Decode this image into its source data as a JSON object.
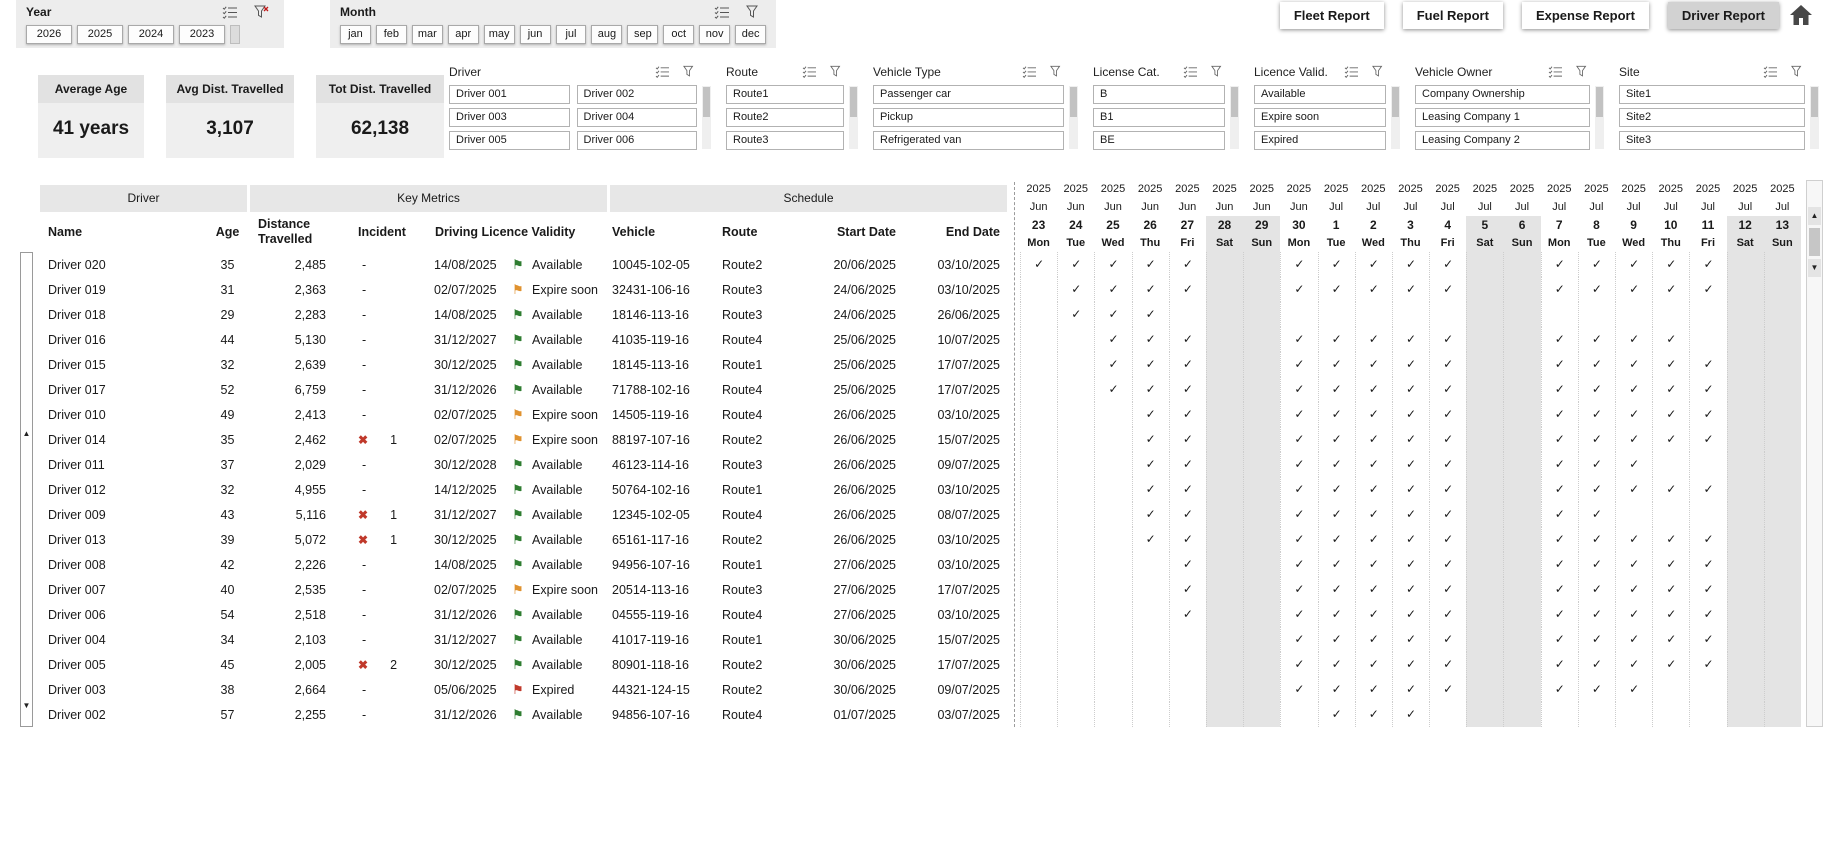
{
  "filters": {
    "year": {
      "label": "Year",
      "options": [
        "2026",
        "2025",
        "2024",
        "2023"
      ]
    },
    "month": {
      "label": "Month",
      "options": [
        "jan",
        "feb",
        "mar",
        "apr",
        "may",
        "jun",
        "jul",
        "aug",
        "sep",
        "oct",
        "nov",
        "dec"
      ]
    }
  },
  "nav": {
    "buttons": [
      {
        "label": "Fleet Report",
        "active": false
      },
      {
        "label": "Fuel Report",
        "active": false
      },
      {
        "label": "Expense Report",
        "active": false
      },
      {
        "label": "Driver Report",
        "active": true
      }
    ]
  },
  "kpis": [
    {
      "title": "Average Age",
      "value": "41 years"
    },
    {
      "title": "Avg Dist. Travelled",
      "value": "3,107"
    },
    {
      "title": "Tot Dist. Travelled",
      "value": "62,138"
    }
  ],
  "slicers": [
    {
      "title": "Driver",
      "columns": 2,
      "items": [
        "Driver 001",
        "Driver 002",
        "Driver 003",
        "Driver 004",
        "Driver 005",
        "Driver 006"
      ]
    },
    {
      "title": "Route",
      "columns": 1,
      "items": [
        "Route1",
        "Route2",
        "Route3"
      ]
    },
    {
      "title": "Vehicle Type",
      "columns": 1,
      "items": [
        "Passenger car",
        "Pickup",
        "Refrigerated van"
      ]
    },
    {
      "title": "License Cat.",
      "columns": 1,
      "items": [
        "B",
        "B1",
        "BE"
      ]
    },
    {
      "title": "Licence Valid.",
      "columns": 1,
      "items": [
        "Available",
        "Expire soon",
        "Expired"
      ]
    },
    {
      "title": "Vehicle Owner",
      "columns": 1,
      "items": [
        "Company Ownership",
        "Leasing Company 1",
        "Leasing Company 2"
      ]
    },
    {
      "title": "Site",
      "columns": 1,
      "items": [
        "Site1",
        "Site2",
        "Site3"
      ]
    }
  ],
  "status_colors": {
    "Available": "#2f7d31",
    "Expire soon": "#e0922f",
    "Expired": "#c0392b",
    "incident": "#c0392b"
  },
  "table": {
    "groups": [
      "Driver",
      "Key Metrics",
      "Schedule"
    ],
    "columns": [
      "Name",
      "Age",
      "Distance Travelled",
      "Incident",
      "Driving Licence Validity",
      "Vehicle",
      "Route",
      "Start Date",
      "End Date"
    ],
    "calendar": {
      "columns": [
        {
          "year": "2025",
          "month": "Jun",
          "day": "23",
          "weekday": "Mon",
          "weekend": false
        },
        {
          "year": "2025",
          "month": "Jun",
          "day": "24",
          "weekday": "Tue",
          "weekend": false
        },
        {
          "year": "2025",
          "month": "Jun",
          "day": "25",
          "weekday": "Wed",
          "weekend": false
        },
        {
          "year": "2025",
          "month": "Jun",
          "day": "26",
          "weekday": "Thu",
          "weekend": false
        },
        {
          "year": "2025",
          "month": "Jun",
          "day": "27",
          "weekday": "Fri",
          "weekend": false
        },
        {
          "year": "2025",
          "month": "Jun",
          "day": "28",
          "weekday": "Sat",
          "weekend": true
        },
        {
          "year": "2025",
          "month": "Jun",
          "day": "29",
          "weekday": "Sun",
          "weekend": true
        },
        {
          "year": "2025",
          "month": "Jun",
          "day": "30",
          "weekday": "Mon",
          "weekend": false
        },
        {
          "year": "2025",
          "month": "Jul",
          "day": "1",
          "weekday": "Tue",
          "weekend": false
        },
        {
          "year": "2025",
          "month": "Jul",
          "day": "2",
          "weekday": "Wed",
          "weekend": false
        },
        {
          "year": "2025",
          "month": "Jul",
          "day": "3",
          "weekday": "Thu",
          "weekend": false
        },
        {
          "year": "2025",
          "month": "Jul",
          "day": "4",
          "weekday": "Fri",
          "weekend": false
        },
        {
          "year": "2025",
          "month": "Jul",
          "day": "5",
          "weekday": "Sat",
          "weekend": true
        },
        {
          "year": "2025",
          "month": "Jul",
          "day": "6",
          "weekday": "Sun",
          "weekend": true
        },
        {
          "year": "2025",
          "month": "Jul",
          "day": "7",
          "weekday": "Mon",
          "weekend": false
        },
        {
          "year": "2025",
          "month": "Jul",
          "day": "8",
          "weekday": "Tue",
          "weekend": false
        },
        {
          "year": "2025",
          "month": "Jul",
          "day": "9",
          "weekday": "Wed",
          "weekend": false
        },
        {
          "year": "2025",
          "month": "Jul",
          "day": "10",
          "weekday": "Thu",
          "weekend": false
        },
        {
          "year": "2025",
          "month": "Jul",
          "day": "11",
          "weekday": "Fri",
          "weekend": false
        },
        {
          "year": "2025",
          "month": "Jul",
          "day": "12",
          "weekday": "Sat",
          "weekend": true
        },
        {
          "year": "2025",
          "month": "Jul",
          "day": "13",
          "weekday": "Sun",
          "weekend": true
        }
      ]
    },
    "rows": [
      {
        "name": "Driver 020",
        "age": "35",
        "distance": "2,485",
        "incident": null,
        "licence_date": "14/08/2025",
        "licence_status": "Available",
        "vehicle": "10045-102-05",
        "route": "Route2",
        "start_date": "20/06/2025",
        "end_date": "03/10/2025",
        "checks": [
          0,
          1,
          2,
          3,
          4,
          7,
          8,
          9,
          10,
          11,
          14,
          15,
          16,
          17,
          18
        ]
      },
      {
        "name": "Driver 019",
        "age": "31",
        "distance": "2,363",
        "incident": null,
        "licence_date": "02/07/2025",
        "licence_status": "Expire soon",
        "vehicle": "32431-106-16",
        "route": "Route3",
        "start_date": "24/06/2025",
        "end_date": "03/10/2025",
        "checks": [
          1,
          2,
          3,
          4,
          7,
          8,
          9,
          10,
          11,
          14,
          15,
          16,
          17,
          18
        ]
      },
      {
        "name": "Driver 018",
        "age": "29",
        "distance": "2,283",
        "incident": null,
        "licence_date": "14/08/2025",
        "licence_status": "Available",
        "vehicle": "18146-113-16",
        "route": "Route3",
        "start_date": "24/06/2025",
        "end_date": "26/06/2025",
        "checks": [
          1,
          2,
          3
        ]
      },
      {
        "name": "Driver 016",
        "age": "44",
        "distance": "5,130",
        "incident": null,
        "licence_date": "31/12/2027",
        "licence_status": "Available",
        "vehicle": "41035-119-16",
        "route": "Route4",
        "start_date": "25/06/2025",
        "end_date": "10/07/2025",
        "checks": [
          2,
          3,
          4,
          7,
          8,
          9,
          10,
          11,
          14,
          15,
          16,
          17
        ]
      },
      {
        "name": "Driver 015",
        "age": "32",
        "distance": "2,639",
        "incident": null,
        "licence_date": "30/12/2025",
        "licence_status": "Available",
        "vehicle": "18145-113-16",
        "route": "Route1",
        "start_date": "25/06/2025",
        "end_date": "17/07/2025",
        "checks": [
          2,
          3,
          4,
          7,
          8,
          9,
          10,
          11,
          14,
          15,
          16,
          17,
          18
        ]
      },
      {
        "name": "Driver 017",
        "age": "52",
        "distance": "6,759",
        "incident": null,
        "licence_date": "31/12/2026",
        "licence_status": "Available",
        "vehicle": "71788-102-16",
        "route": "Route4",
        "start_date": "25/06/2025",
        "end_date": "17/07/2025",
        "checks": [
          2,
          3,
          4,
          7,
          8,
          9,
          10,
          11,
          14,
          15,
          16,
          17,
          18
        ]
      },
      {
        "name": "Driver 010",
        "age": "49",
        "distance": "2,413",
        "incident": null,
        "licence_date": "02/07/2025",
        "licence_status": "Expire soon",
        "vehicle": "14505-119-16",
        "route": "Route4",
        "start_date": "26/06/2025",
        "end_date": "03/10/2025",
        "checks": [
          3,
          4,
          7,
          8,
          9,
          10,
          11,
          14,
          15,
          16,
          17,
          18
        ]
      },
      {
        "name": "Driver 014",
        "age": "35",
        "distance": "2,462",
        "incident": 1,
        "licence_date": "02/07/2025",
        "licence_status": "Expire soon",
        "vehicle": "88197-107-16",
        "route": "Route2",
        "start_date": "26/06/2025",
        "end_date": "15/07/2025",
        "checks": [
          3,
          4,
          7,
          8,
          9,
          10,
          11,
          14,
          15,
          16,
          17,
          18
        ]
      },
      {
        "name": "Driver 011",
        "age": "37",
        "distance": "2,029",
        "incident": null,
        "licence_date": "30/12/2028",
        "licence_status": "Available",
        "vehicle": "46123-114-16",
        "route": "Route3",
        "start_date": "26/06/2025",
        "end_date": "09/07/2025",
        "checks": [
          3,
          4,
          7,
          8,
          9,
          10,
          11,
          14,
          15,
          16
        ]
      },
      {
        "name": "Driver 012",
        "age": "32",
        "distance": "4,955",
        "incident": null,
        "licence_date": "14/12/2025",
        "licence_status": "Available",
        "vehicle": "50764-102-16",
        "route": "Route1",
        "start_date": "26/06/2025",
        "end_date": "03/10/2025",
        "checks": [
          3,
          4,
          7,
          8,
          9,
          10,
          11,
          14,
          15,
          16,
          17,
          18
        ]
      },
      {
        "name": "Driver 009",
        "age": "43",
        "distance": "5,116",
        "incident": 1,
        "licence_date": "31/12/2027",
        "licence_status": "Available",
        "vehicle": "12345-102-05",
        "route": "Route4",
        "start_date": "26/06/2025",
        "end_date": "08/07/2025",
        "checks": [
          3,
          4,
          7,
          8,
          9,
          10,
          11,
          14,
          15
        ]
      },
      {
        "name": "Driver 013",
        "age": "39",
        "distance": "5,072",
        "incident": 1,
        "licence_date": "30/12/2025",
        "licence_status": "Available",
        "vehicle": "65161-117-16",
        "route": "Route2",
        "start_date": "26/06/2025",
        "end_date": "03/10/2025",
        "checks": [
          3,
          4,
          7,
          8,
          9,
          10,
          11,
          14,
          15,
          16,
          17,
          18
        ]
      },
      {
        "name": "Driver 008",
        "age": "42",
        "distance": "2,226",
        "incident": null,
        "licence_date": "14/08/2025",
        "licence_status": "Available",
        "vehicle": "94956-107-16",
        "route": "Route1",
        "start_date": "27/06/2025",
        "end_date": "03/10/2025",
        "checks": [
          4,
          7,
          8,
          9,
          10,
          11,
          14,
          15,
          16,
          17,
          18
        ]
      },
      {
        "name": "Driver 007",
        "age": "40",
        "distance": "2,535",
        "incident": null,
        "licence_date": "02/07/2025",
        "licence_status": "Expire soon",
        "vehicle": "20514-113-16",
        "route": "Route3",
        "start_date": "27/06/2025",
        "end_date": "17/07/2025",
        "checks": [
          4,
          7,
          8,
          9,
          10,
          11,
          14,
          15,
          16,
          17,
          18
        ]
      },
      {
        "name": "Driver 006",
        "age": "54",
        "distance": "2,518",
        "incident": null,
        "licence_date": "31/12/2026",
        "licence_status": "Available",
        "vehicle": "04555-119-16",
        "route": "Route4",
        "start_date": "27/06/2025",
        "end_date": "03/10/2025",
        "checks": [
          4,
          7,
          8,
          9,
          10,
          11,
          14,
          15,
          16,
          17,
          18
        ]
      },
      {
        "name": "Driver 004",
        "age": "34",
        "distance": "2,103",
        "incident": null,
        "licence_date": "31/12/2027",
        "licence_status": "Available",
        "vehicle": "41017-119-16",
        "route": "Route1",
        "start_date": "30/06/2025",
        "end_date": "15/07/2025",
        "checks": [
          7,
          8,
          9,
          10,
          11,
          14,
          15,
          16,
          17,
          18
        ]
      },
      {
        "name": "Driver 005",
        "age": "45",
        "distance": "2,005",
        "incident": 2,
        "licence_date": "30/12/2025",
        "licence_status": "Available",
        "vehicle": "80901-118-16",
        "route": "Route2",
        "start_date": "30/06/2025",
        "end_date": "17/07/2025",
        "checks": [
          7,
          8,
          9,
          10,
          11,
          14,
          15,
          16,
          17,
          18
        ]
      },
      {
        "name": "Driver 003",
        "age": "38",
        "distance": "2,664",
        "incident": null,
        "licence_date": "05/06/2025",
        "licence_status": "Expired",
        "vehicle": "44321-124-15",
        "route": "Route2",
        "start_date": "30/06/2025",
        "end_date": "09/07/2025",
        "checks": [
          7,
          8,
          9,
          10,
          11,
          14,
          15,
          16
        ]
      },
      {
        "name": "Driver 002",
        "age": "57",
        "distance": "2,255",
        "incident": null,
        "licence_date": "31/12/2026",
        "licence_status": "Available",
        "vehicle": "94856-107-16",
        "route": "Route4",
        "start_date": "01/07/2025",
        "end_date": "03/07/2025",
        "checks": [
          8,
          9,
          10
        ]
      }
    ]
  }
}
